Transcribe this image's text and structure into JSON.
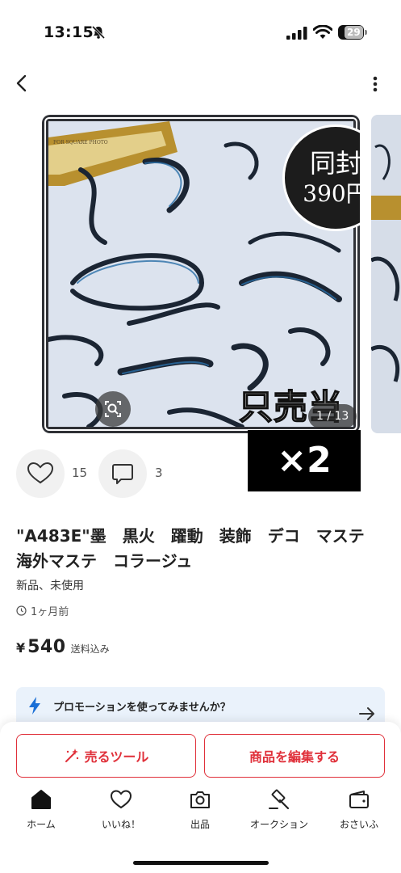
{
  "status_bar": {
    "time": "13:15",
    "battery": "29"
  },
  "photo": {
    "badge_line1": "同封",
    "badge_line2": "390円",
    "sold_text": "只売当",
    "counter": "1 / 13",
    "quantity_overlay": "×2",
    "frame_text": "FOR SQUARE PHOTO"
  },
  "engagement": {
    "likes": "15",
    "comments": "3"
  },
  "product": {
    "title": "\"A483E\"墨　黒火　躍動　装飾　デコ　マステ　海外マステ　コラージュ",
    "condition": "新品、未使用",
    "posted": "1ヶ月前",
    "price_symbol": "¥",
    "price": "540",
    "shipping": "送料込み"
  },
  "promotion": {
    "text": "プロモーションを使ってみませんか？"
  },
  "actions": {
    "sell_tools": "売るツール",
    "edit_item": "商品を編集する"
  },
  "tabs": [
    {
      "label": "ホーム",
      "icon": "home-icon"
    },
    {
      "label": "いいね！",
      "icon": "heart-icon"
    },
    {
      "label": "出品",
      "icon": "camera-icon"
    },
    {
      "label": "オークション",
      "icon": "gavel-icon"
    },
    {
      "label": "おさいふ",
      "icon": "wallet-icon"
    }
  ],
  "colors": {
    "accent": "#e0303a",
    "promo_bg": "#eaf2fb",
    "promo_icon": "#1a6fd6"
  }
}
